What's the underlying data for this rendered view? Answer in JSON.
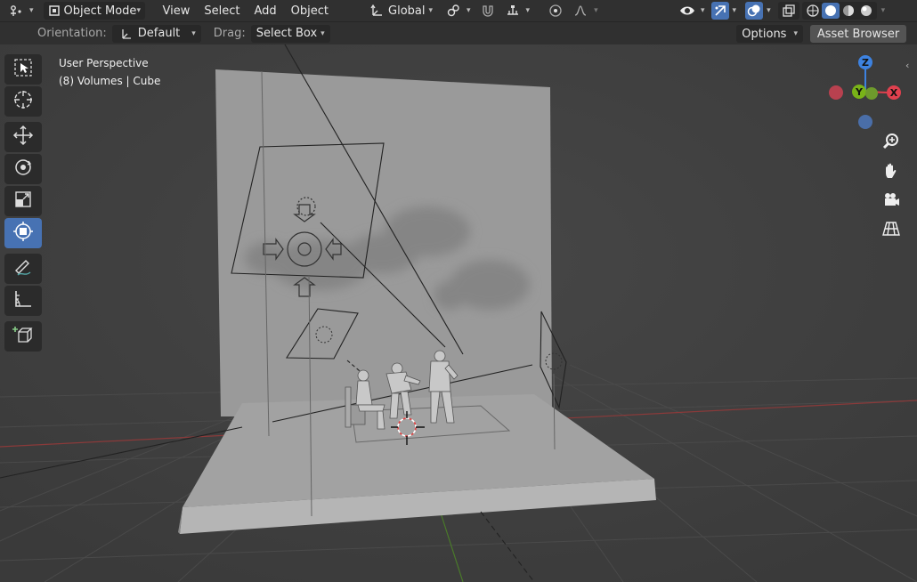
{
  "header": {
    "editor_type_icon": "3d-viewport-icon",
    "mode": "Object Mode",
    "menus": [
      "View",
      "Select",
      "Add",
      "Object"
    ],
    "transform_orientation": "Global"
  },
  "tool_header": {
    "orientation_label": "Orientation:",
    "orientation_value": "Default",
    "drag_label": "Drag:",
    "drag_value": "Select Box",
    "options_label": "Options",
    "asset_browser_label": "Asset Browser"
  },
  "viewport": {
    "view_name": "User Perspective",
    "collection_info": "(8) Volumes | Cube"
  },
  "gizmo": {
    "z_label": "Z",
    "y_label": "Y",
    "x_label": "X"
  },
  "toolbar": [
    {
      "name": "select-box-tool",
      "icon": "select-box-icon"
    },
    {
      "name": "cursor-tool",
      "icon": "cursor-icon"
    },
    {
      "name": "move-tool",
      "icon": "move-icon"
    },
    {
      "name": "rotate-tool",
      "icon": "rotate-icon"
    },
    {
      "name": "scale-tool",
      "icon": "scale-icon"
    },
    {
      "name": "transform-tool",
      "icon": "transform-icon",
      "active": true
    },
    {
      "name": "annotate-tool",
      "icon": "annotate-icon"
    },
    {
      "name": "measure-tool",
      "icon": "measure-icon"
    },
    {
      "name": "add-cube-tool",
      "icon": "add-cube-icon"
    }
  ],
  "colors": {
    "accent": "#4772b3",
    "axis_x": "#e0404e",
    "axis_y": "#79b318",
    "axis_z": "#3d82e0"
  }
}
